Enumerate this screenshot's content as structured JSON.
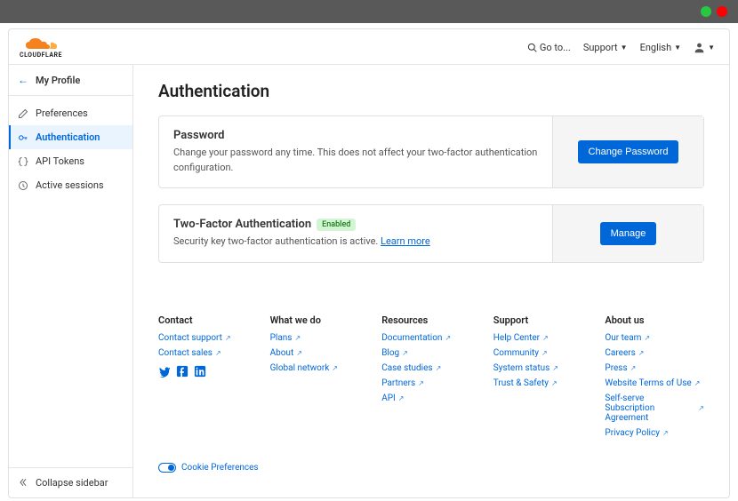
{
  "brand": "CLOUDFLARE",
  "topbar": {
    "goto": "Go to...",
    "support": "Support",
    "language": "English"
  },
  "sidebar": {
    "title": "My Profile",
    "items": [
      {
        "label": "Preferences"
      },
      {
        "label": "Authentication"
      },
      {
        "label": "API Tokens"
      },
      {
        "label": "Active sessions"
      }
    ],
    "collapse": "Collapse sidebar"
  },
  "page": {
    "title": "Authentication",
    "password": {
      "heading": "Password",
      "desc": "Change your password any time. This does not affect your two-factor authentication configuration.",
      "button": "Change Password"
    },
    "twofa": {
      "heading": "Two-Factor Authentication",
      "badge": "Enabled",
      "desc_pre": "Security key two-factor authentication is active. ",
      "learn_more": "Learn more",
      "button": "Manage"
    }
  },
  "footer": {
    "contact": {
      "heading": "Contact",
      "links": [
        "Contact support",
        "Contact sales"
      ]
    },
    "whatwedo": {
      "heading": "What we do",
      "links": [
        "Plans",
        "About",
        "Global network"
      ]
    },
    "resources": {
      "heading": "Resources",
      "links": [
        "Documentation",
        "Blog",
        "Case studies",
        "Partners",
        "API"
      ]
    },
    "support": {
      "heading": "Support",
      "links": [
        "Help Center",
        "Community",
        "System status",
        "Trust & Safety"
      ]
    },
    "about": {
      "heading": "About us",
      "links": [
        "Our team",
        "Careers",
        "Press",
        "Website Terms of Use",
        "Self-serve Subscription Agreement",
        "Privacy Policy"
      ]
    }
  },
  "cookie_prefs": "Cookie Preferences"
}
